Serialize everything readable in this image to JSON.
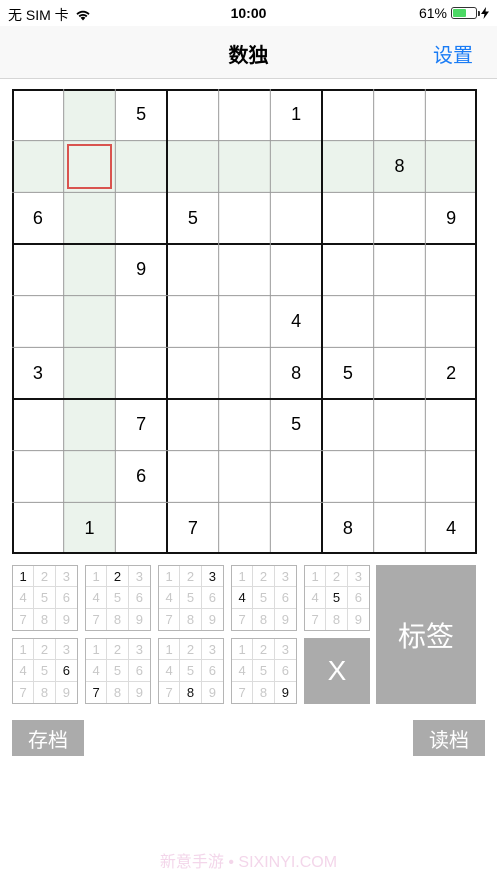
{
  "status": {
    "carrier": "无 SIM 卡",
    "time": "10:00",
    "battery": "61%",
    "battery_level": 0.61
  },
  "nav": {
    "title": "数独",
    "settings": "设置"
  },
  "board": {
    "grid": [
      [
        "",
        "",
        "5",
        "",
        "",
        "1",
        "",
        "",
        ""
      ],
      [
        "",
        "",
        "",
        "",
        "",
        "",
        "",
        "8",
        ""
      ],
      [
        "6",
        "",
        "",
        "5",
        "",
        "",
        "",
        "",
        "9"
      ],
      [
        "",
        "",
        "9",
        "",
        "",
        "",
        "",
        "",
        ""
      ],
      [
        "",
        "",
        "",
        "",
        "",
        "4",
        "",
        "",
        ""
      ],
      [
        "3",
        "",
        "",
        "",
        "",
        "8",
        "5",
        "",
        "2"
      ],
      [
        "",
        "",
        "7",
        "",
        "",
        "5",
        "",
        "",
        ""
      ],
      [
        "",
        "",
        "6",
        "",
        "",
        "",
        "",
        "",
        ""
      ],
      [
        "",
        "1",
        "",
        "7",
        "",
        "",
        "8",
        "",
        "4"
      ]
    ],
    "selected": {
      "row": 1,
      "col": 1
    }
  },
  "pads": {
    "digits": [
      "1",
      "2",
      "3",
      "4",
      "5",
      "6",
      "7",
      "8",
      "9"
    ],
    "items": [
      1,
      2,
      3,
      4,
      5,
      6,
      7,
      8,
      9
    ]
  },
  "buttons": {
    "mark": "标签",
    "clear": "X",
    "save": "存档",
    "load": "读档"
  },
  "watermark": "新意手游 • SIXINYI.COM",
  "colors": {
    "highlight": "#ebf3ec",
    "selection": "#d9534f",
    "accent": "#1a7cf5",
    "button": "#ababab"
  }
}
